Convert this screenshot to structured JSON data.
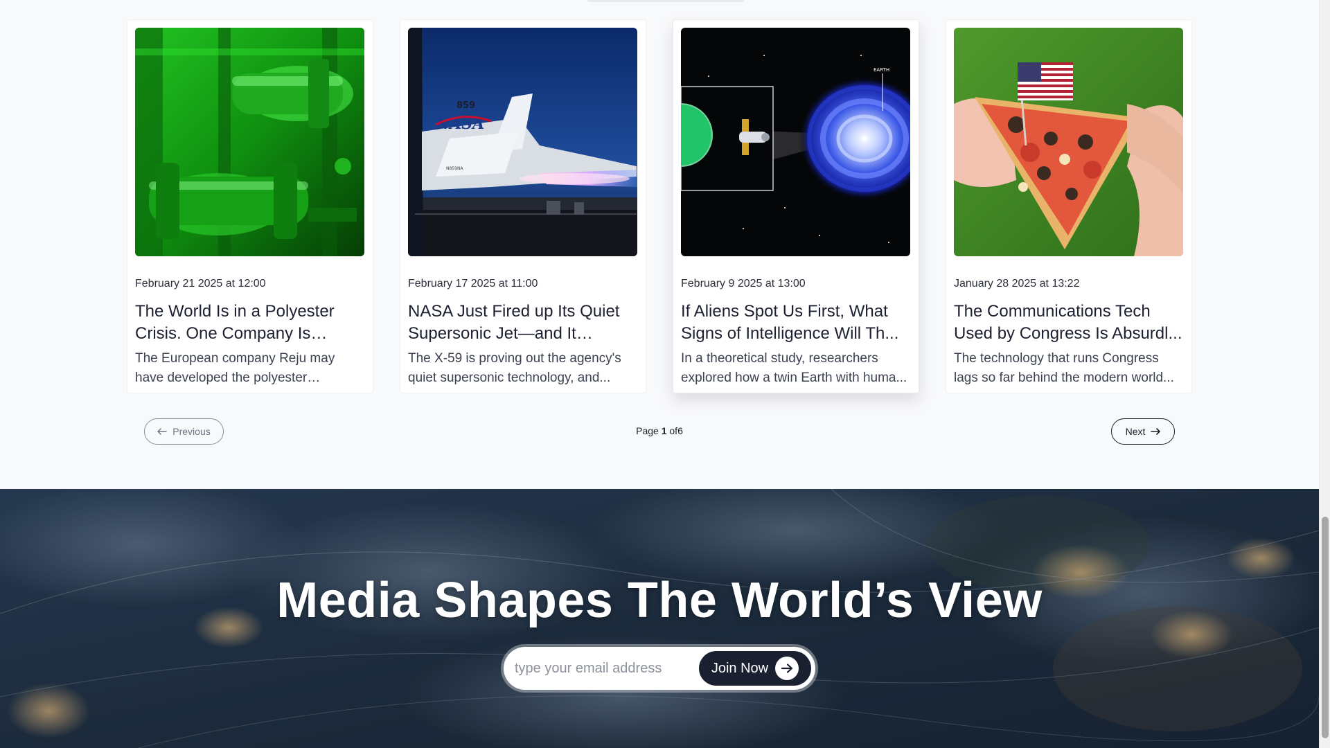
{
  "articles": [
    {
      "date": "February 21 2025 at 12:00",
      "title": "The World Is in a Polyester Crisis. One Company Is Tryin...",
      "excerpt": "The European company Reju may have developed the polyester recycling..."
    },
    {
      "date": "February 17 2025 at 11:00",
      "title": "NASA Just Fired up Its Quiet Supersonic Jet—and It Looks...",
      "excerpt": "The X-59 is proving out the agency's quiet supersonic technology, and...",
      "image_text": {
        "tail_number": "859",
        "logo": "NASA",
        "reg": "N859NA"
      }
    },
    {
      "date": "February 9 2025 at 13:00",
      "title": "If Aliens Spot Us First, What Signs of Intelligence Will Th...",
      "excerpt": "In a theoretical study, researchers explored how a twin Earth with huma...",
      "image_text": {
        "label": "EARTH"
      }
    },
    {
      "date": "January 28 2025 at 13:22",
      "title": "The Communications Tech Used by Congress Is Absurdl...",
      "excerpt": "The technology that runs Congress lags so far behind the modern world..."
    }
  ],
  "pagination": {
    "previous_label": "Previous",
    "next_label": "Next",
    "page_prefix": "Page",
    "current_page": "1",
    "of_text": "of",
    "total_pages": "6"
  },
  "newsletter": {
    "headline": "Media Shapes The World’s View",
    "email_placeholder": "type your email address",
    "join_label": "Join Now"
  },
  "colors": {
    "background": "#f8f9fb",
    "text_dark": "#1b1e2b",
    "button_dark": "#1b2030",
    "hero_overlay": "#1d2a3a"
  },
  "icons": {
    "previous": "arrow-left-icon",
    "next": "arrow-right-icon",
    "join": "circle-arrow-right-icon"
  }
}
